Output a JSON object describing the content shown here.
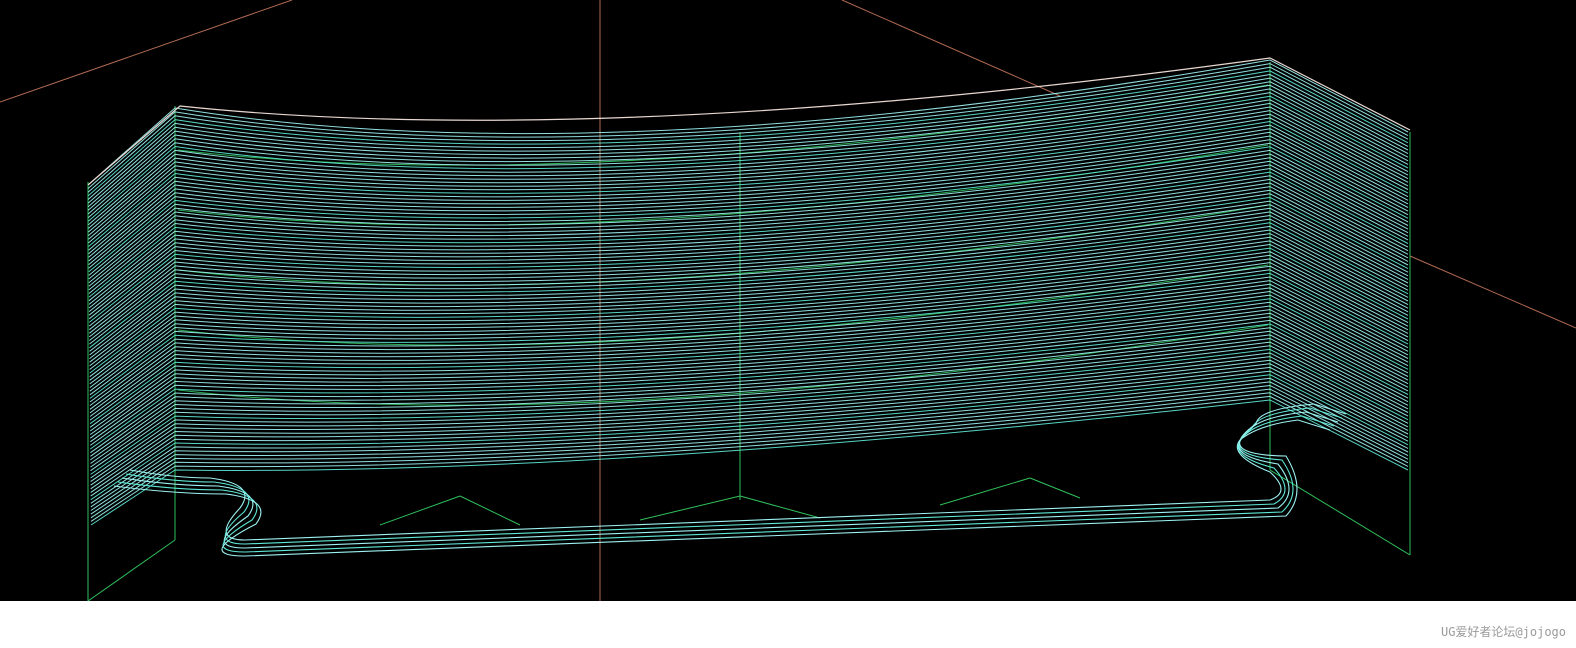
{
  "viewport": {
    "background": "#000000",
    "toolpath_color": "#9ef2f2",
    "toolpath_accent_color": "#5fe8d6",
    "boundary_color": "#2fbf5a",
    "datum_axis_color": "#b06a52"
  },
  "footer": {
    "watermark_text": "UG爱好者论坛@jojogo"
  }
}
